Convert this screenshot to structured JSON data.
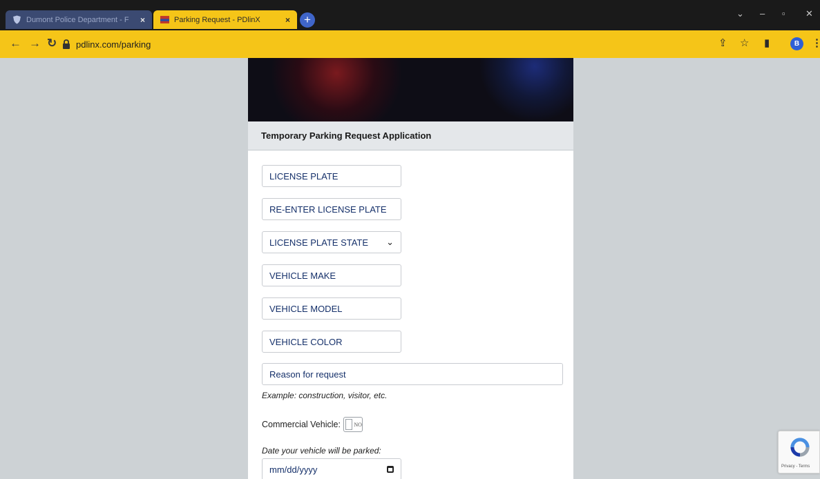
{
  "browser": {
    "tabs": [
      {
        "title": "Dumont Police Department - F",
        "active": false
      },
      {
        "title": "Parking Request - PDlinX",
        "active": true
      }
    ],
    "tab_close_glyph": "×",
    "new_tab_glyph": "+",
    "url": "pdlinx.com/parking",
    "window_controls": {
      "chevron": "⌄",
      "minimize": "–",
      "restore": "▫",
      "close": "✕"
    },
    "nav": {
      "back": "←",
      "forward": "→",
      "reload": "↻"
    },
    "toolbar": {
      "share": "⇪",
      "star": "☆",
      "sidepanel": "▮",
      "menu": "⋮"
    },
    "profile_initial": "B",
    "theme_color": "#f5c518"
  },
  "form": {
    "header": "Temporary Parking Request Application",
    "license_plate_placeholder": "LICENSE PLATE",
    "reenter_plate_placeholder": "RE-ENTER LICENSE PLATE",
    "plate_state_selected": "LICENSE PLATE STATE",
    "vehicle_make_placeholder": "VEHICLE MAKE",
    "vehicle_model_placeholder": "VEHICLE MODEL",
    "vehicle_color_placeholder": "VEHICLE COLOR",
    "reason_placeholder": "Reason for request",
    "reason_hint": "Example: construction, visitor, etc.",
    "commercial_label": "Commercial Vehicle:",
    "commercial_toggle": "NO",
    "date_label": "Date your vehicle will be parked:",
    "date_placeholder": "mm/dd/yyyy"
  },
  "recaptcha": {
    "text": "Privacy - Terms"
  }
}
